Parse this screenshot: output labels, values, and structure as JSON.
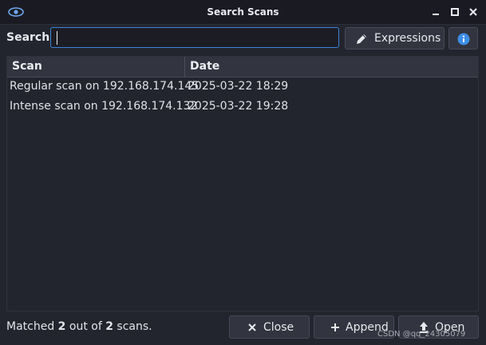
{
  "window": {
    "title": "Search Scans"
  },
  "search": {
    "label": "Search:",
    "value": "",
    "placeholder": ""
  },
  "toolbar": {
    "expressions_label": "Expressions"
  },
  "table": {
    "columns": [
      "Scan",
      "Date"
    ],
    "rows": [
      {
        "scan": "Regular scan on 192.168.174.145",
        "date": "2025-03-22 18:29"
      },
      {
        "scan": "Intense scan on 192.168.174.132",
        "date": "2025-03-22 19:28"
      }
    ]
  },
  "status": {
    "prefix": "Matched",
    "matched": "2",
    "middle": "out of",
    "total": "2",
    "suffix": "scans."
  },
  "buttons": {
    "close": "Close",
    "append": "Append",
    "open": "Open"
  },
  "watermark": "CSDN @qq_24305079",
  "icons": {
    "app": "eye-icon",
    "minimize": "minimize-icon",
    "maximize": "maximize-icon",
    "close": "close-icon",
    "expressions": "pencil-icon",
    "info": "info-icon",
    "close_button": "x-icon",
    "append_button": "plus-icon",
    "open_button": "upload-arrow-icon"
  },
  "colors": {
    "accent": "#3a84d8",
    "background": "#23252e",
    "button": "#32343f"
  }
}
